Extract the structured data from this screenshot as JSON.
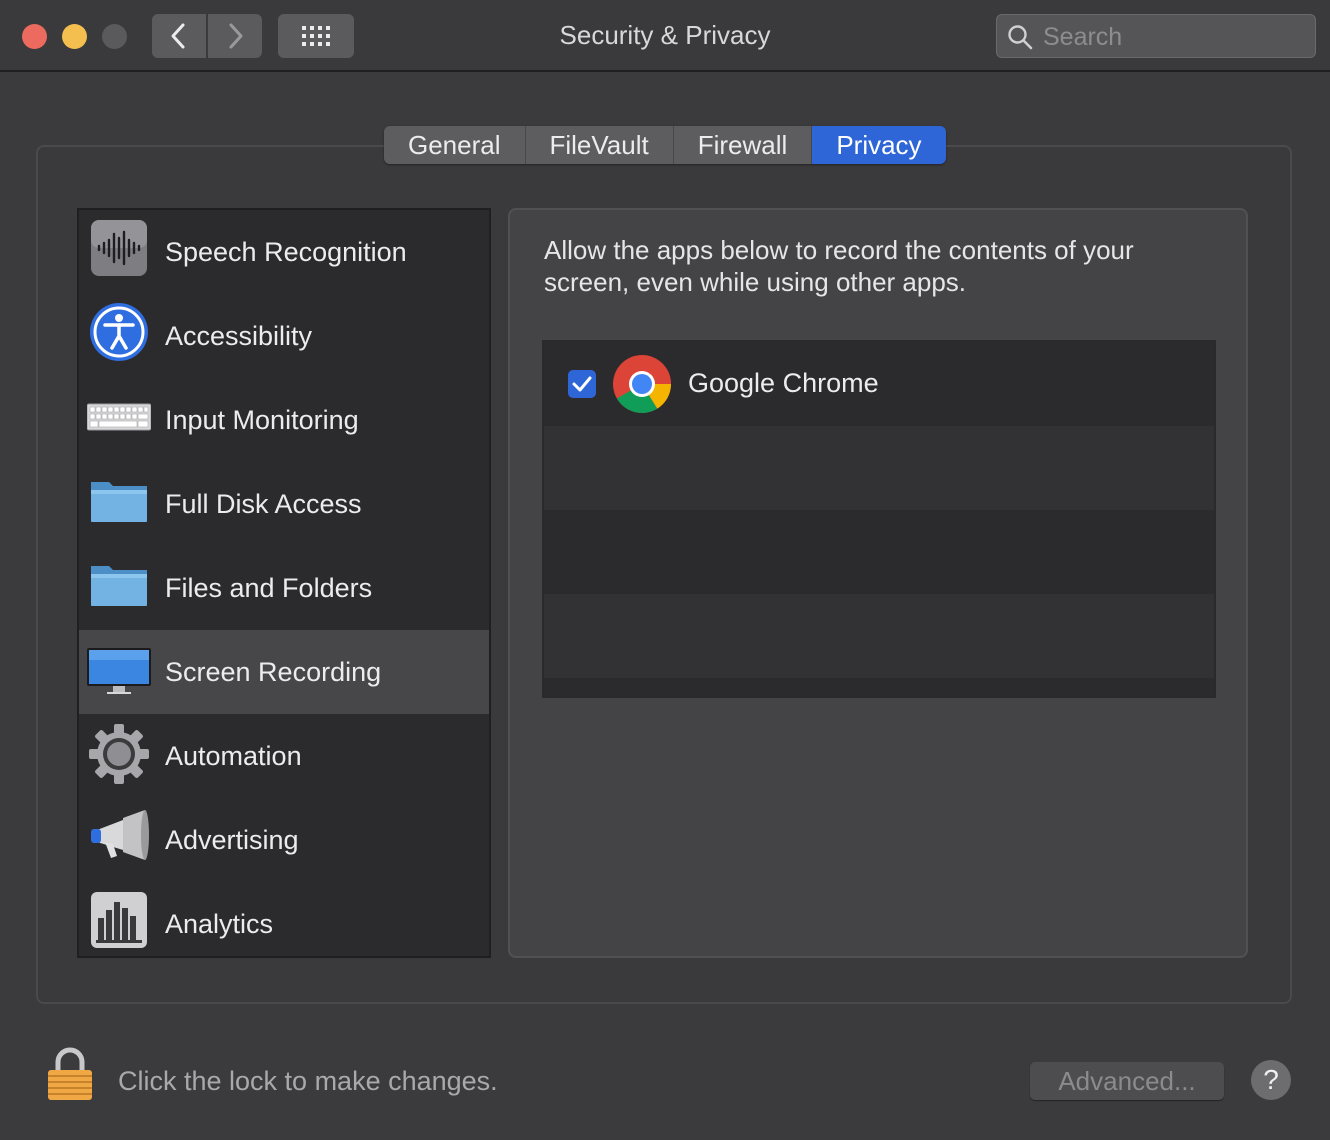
{
  "window": {
    "title": "Security & Privacy",
    "search_placeholder": "Search"
  },
  "tabs": [
    {
      "label": "General"
    },
    {
      "label": "FileVault"
    },
    {
      "label": "Firewall"
    },
    {
      "label": "Privacy",
      "active": true
    }
  ],
  "sidebar": {
    "items": [
      {
        "label": "Speech Recognition",
        "icon": "waveform-icon"
      },
      {
        "label": "Accessibility",
        "icon": "accessibility-icon"
      },
      {
        "label": "Input Monitoring",
        "icon": "keyboard-icon"
      },
      {
        "label": "Full Disk Access",
        "icon": "folder-icon"
      },
      {
        "label": "Files and Folders",
        "icon": "folder-icon"
      },
      {
        "label": "Screen Recording",
        "icon": "monitor-icon",
        "selected": true
      },
      {
        "label": "Automation",
        "icon": "gear-icon"
      },
      {
        "label": "Advertising",
        "icon": "megaphone-icon"
      },
      {
        "label": "Analytics",
        "icon": "bar-chart-icon"
      }
    ]
  },
  "main": {
    "description": "Allow the apps below to record the contents of your screen, even while using other apps.",
    "apps": [
      {
        "name": "Google Chrome",
        "checked": true,
        "icon": "chrome-icon"
      }
    ]
  },
  "footer": {
    "lock_text": "Click the lock to make changes.",
    "advanced_label": "Advanced...",
    "help_label": "?"
  },
  "colors": {
    "accent": "#2e66d7",
    "background": "#3b3b3d"
  }
}
